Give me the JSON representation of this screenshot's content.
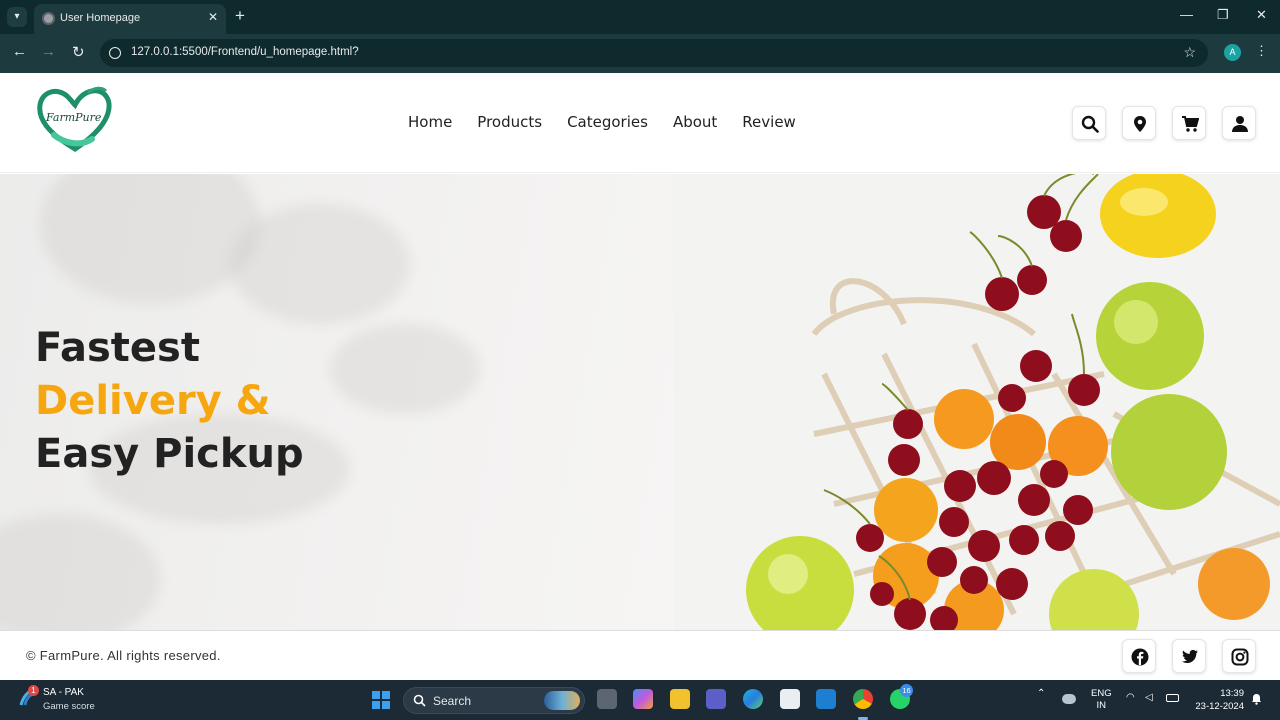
{
  "browser": {
    "tab_title": "User Homepage",
    "url": "127.0.0.1:5500/Frontend/u_homepage.html?",
    "profile_initial": "A"
  },
  "site": {
    "brand": "FarmPure",
    "nav": [
      "Home",
      "Products",
      "Categories",
      "About",
      "Review"
    ],
    "header_icons": [
      "search-icon",
      "location-icon",
      "cart-icon",
      "user-icon"
    ]
  },
  "hero": {
    "line1": "Fastest",
    "line2": "Delivery &",
    "line3": "Easy Pickup",
    "accent_color": "#f6a70f"
  },
  "footer": {
    "copyright": "© FarmPure. All rights reserved.",
    "social": [
      "facebook-icon",
      "twitter-icon",
      "instagram-icon"
    ]
  },
  "taskbar": {
    "weather_title": "SA - PAK",
    "weather_subtitle": "Game score",
    "weather_badge": "1",
    "search_label": "Search",
    "whatsapp_badge": "16",
    "lang_top": "ENG",
    "lang_bottom": "IN",
    "time": "13:39",
    "date": "23-12-2024"
  }
}
